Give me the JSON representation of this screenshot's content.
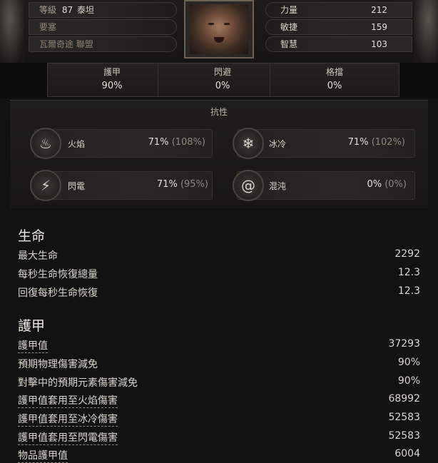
{
  "header": {
    "character": {
      "level_label": "等級",
      "level": "87",
      "class": "泰坦"
    },
    "stronghold": "要塞",
    "guild": "瓦爾奇途 聯盟",
    "attributes": [
      {
        "label": "力量",
        "value": "212"
      },
      {
        "label": "敏捷",
        "value": "159"
      },
      {
        "label": "智慧",
        "value": "103"
      }
    ]
  },
  "defense": {
    "armor": {
      "label": "護甲",
      "value": "90%"
    },
    "dodge": {
      "label": "閃避",
      "value": "0%"
    },
    "block": {
      "label": "格擋",
      "value": "0%"
    }
  },
  "resistances": {
    "title": "抗性",
    "fire": {
      "label": "火焰",
      "value": "71%",
      "max": "(108%)"
    },
    "cold": {
      "label": "冰冷",
      "value": "71%",
      "max": "(102%)"
    },
    "lightning": {
      "label": "閃電",
      "value": "71%",
      "max": "(95%)"
    },
    "chaos": {
      "label": "混沌",
      "value": "0%",
      "max": "(0%)"
    }
  },
  "life": {
    "title": "生命",
    "rows": [
      {
        "label": "最大生命",
        "value": "2292"
      },
      {
        "label": "每秒生命恢復總量",
        "value": "12.3"
      },
      {
        "label": "回復每秒生命恢復",
        "value": "12.3"
      }
    ]
  },
  "armor_section": {
    "title": "護甲",
    "rows": [
      {
        "label": "護甲值",
        "value": "37293"
      },
      {
        "label": "預期物理傷害減免",
        "value": "90%"
      },
      {
        "label": "對擊中的預期元素傷害減免",
        "value": "90%"
      },
      {
        "label": "護甲值套用至火焰傷害",
        "value": "68992"
      },
      {
        "label": "護甲值套用至冰冷傷害",
        "value": "52583"
      },
      {
        "label": "護甲值套用至閃電傷害",
        "value": "52583"
      },
      {
        "label": "物品護甲值",
        "value": "6004"
      }
    ]
  },
  "icons": {
    "fire": "fire-icon",
    "cold": "snowflake-icon",
    "lightning": "lightning-icon",
    "chaos": "spiral-icon"
  }
}
